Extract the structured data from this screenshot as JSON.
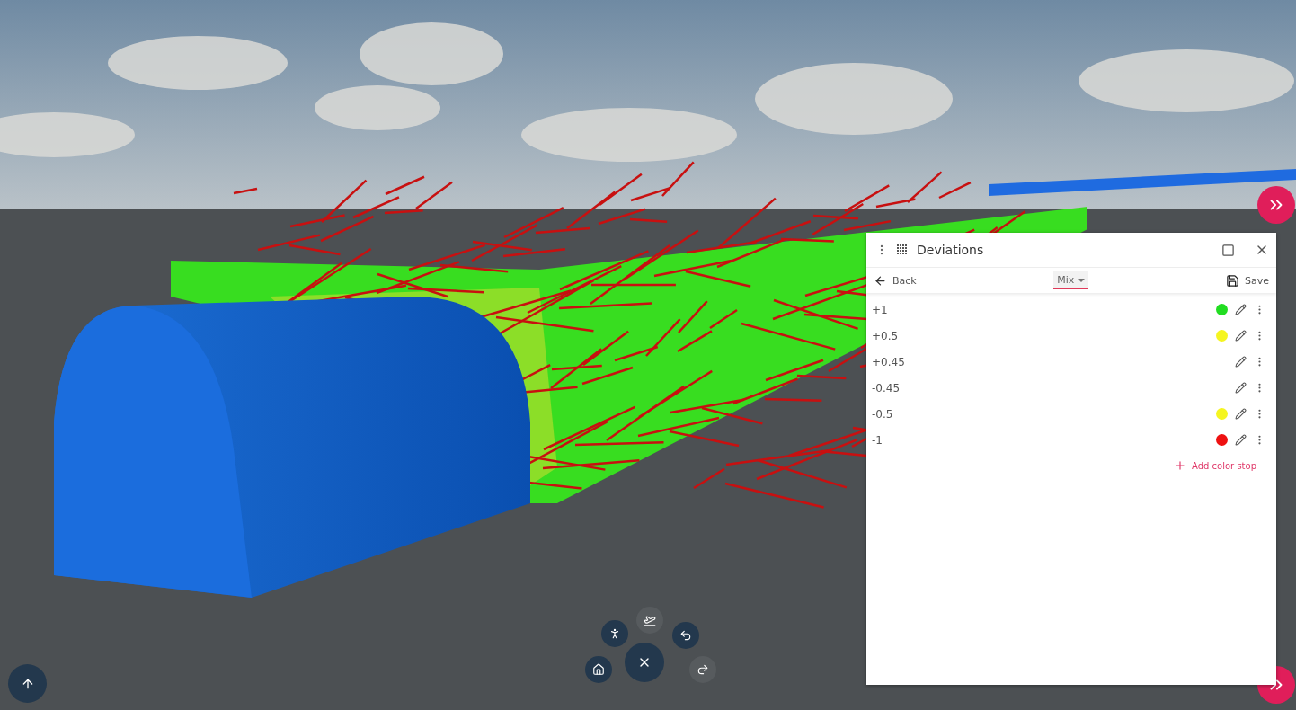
{
  "panel": {
    "title": "Deviations",
    "back_label": "Back",
    "mode": "Mix",
    "save_label": "Save",
    "color_stops": [
      {
        "label": "+1",
        "color": "#22dd22"
      },
      {
        "label": "+0.5",
        "color": "#f5f520"
      },
      {
        "label": "+0.45"
      },
      {
        "label": "-0.45"
      },
      {
        "label": "-0.5",
        "color": "#f5f520"
      },
      {
        "label": "-1",
        "color": "#ee1111"
      }
    ],
    "add_label": "Add color stop"
  },
  "navigation": [
    {
      "kind": "walk",
      "disabled": false
    },
    {
      "kind": "fly",
      "disabled": true
    },
    {
      "kind": "undo",
      "disabled": false
    },
    {
      "kind": "home",
      "disabled": false
    },
    {
      "kind": "close",
      "disabled": false
    },
    {
      "kind": "redo",
      "disabled": true
    }
  ]
}
